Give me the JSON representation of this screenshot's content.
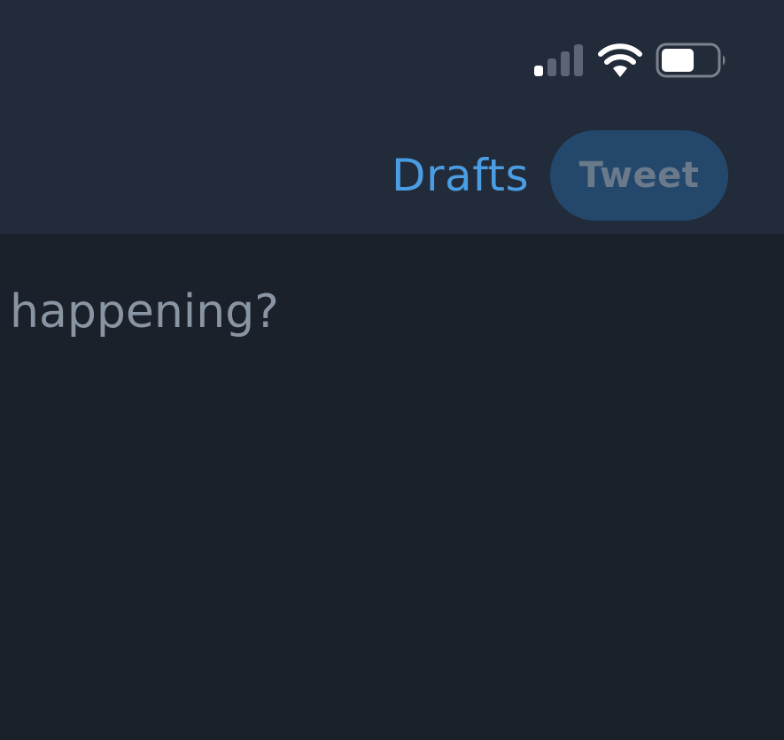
{
  "status_bar": {
    "signal_icon": "cellular-signal-icon",
    "wifi_icon": "wifi-icon",
    "battery_icon": "battery-icon",
    "signal_level": 1,
    "battery_level": 0.55
  },
  "toolbar": {
    "drafts_label": "Drafts",
    "tweet_label": "Tweet"
  },
  "compose": {
    "placeholder_visible": "happening?"
  },
  "colors": {
    "accent": "#4a9de3",
    "tweet_button_disabled_bg": "#24486c",
    "header_bg": "#222b39",
    "body_bg": "#1b212b"
  }
}
